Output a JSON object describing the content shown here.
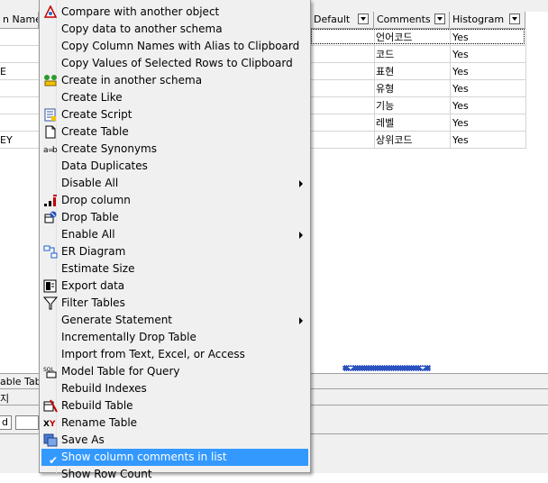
{
  "grid": {
    "columns": [
      {
        "label": "n Name"
      },
      {
        "label": "Default"
      },
      {
        "label": "Comments"
      },
      {
        "label": "Histogram"
      }
    ],
    "rows": [
      {
        "left": "",
        "comment": "언어코드",
        "histogram": "Yes"
      },
      {
        "left": "",
        "comment": "코드",
        "histogram": "Yes"
      },
      {
        "left": "E",
        "comment": "표현",
        "histogram": "Yes"
      },
      {
        "left": "",
        "comment": "유형",
        "histogram": "Yes"
      },
      {
        "left": "",
        "comment": "기능",
        "histogram": "Yes"
      },
      {
        "left": "",
        "comment": "레벨",
        "histogram": "Yes"
      },
      {
        "left": "EY",
        "comment": "상위코드",
        "histogram": "Yes"
      }
    ]
  },
  "bottom": {
    "tab_label": "able Table",
    "row2_label": "지",
    "status_label": "d"
  },
  "menu": {
    "items": [
      {
        "label": "Compare with another object",
        "icon": "compare-icon"
      },
      {
        "label": "Copy data to another schema",
        "icon": ""
      },
      {
        "label": "Copy Column Names with Alias to Clipboard",
        "icon": ""
      },
      {
        "label": "Copy Values of Selected Rows to Clipboard",
        "icon": ""
      },
      {
        "label": "Create in another schema",
        "icon": "create-schema-icon"
      },
      {
        "label": "Create Like",
        "icon": ""
      },
      {
        "label": "Create Script",
        "icon": "script-icon"
      },
      {
        "label": "Create Table",
        "icon": "new-table-icon"
      },
      {
        "label": "Create Synonyms",
        "icon": "synonym-icon"
      },
      {
        "label": "Data Duplicates",
        "icon": ""
      },
      {
        "label": "Disable All",
        "icon": "",
        "submenu": true
      },
      {
        "label": "Drop column",
        "icon": "drop-column-icon"
      },
      {
        "label": "Drop Table",
        "icon": "drop-table-icon"
      },
      {
        "label": "Enable All",
        "icon": "",
        "submenu": true
      },
      {
        "label": "ER Diagram",
        "icon": "er-diagram-icon"
      },
      {
        "label": "Estimate Size",
        "icon": ""
      },
      {
        "label": "Export data",
        "icon": "export-icon"
      },
      {
        "label": "Filter Tables",
        "icon": "filter-icon"
      },
      {
        "label": "Generate Statement",
        "icon": "",
        "submenu": true
      },
      {
        "label": "Incrementally Drop Table",
        "icon": ""
      },
      {
        "label": "Import from Text, Excel, or Access",
        "icon": ""
      },
      {
        "label": "Model Table for Query",
        "icon": "sql-icon"
      },
      {
        "label": "Rebuild Indexes",
        "icon": ""
      },
      {
        "label": "Rebuild Table",
        "icon": "rebuild-icon"
      },
      {
        "label": "Rename Table",
        "icon": "rename-icon"
      },
      {
        "label": "Save As",
        "icon": "save-as-icon"
      },
      {
        "label": "Show column comments in list",
        "icon": "check-icon",
        "checked": true,
        "highlighted": true
      },
      {
        "label": "Show Row Count",
        "icon": ""
      }
    ]
  },
  "colors": {
    "highlight": "#3399ff",
    "menu_bg": "#f0f0f0"
  }
}
